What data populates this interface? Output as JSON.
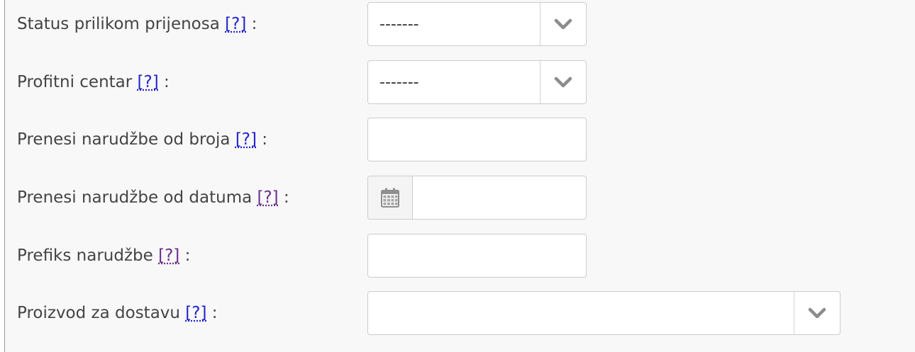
{
  "form": {
    "help_marker": "[?]",
    "rows": [
      {
        "label": "Status prilikom prijenosa",
        "value": "-------",
        "help_visited": false
      },
      {
        "label": "Profitni centar",
        "value": "-------",
        "help_visited": false
      },
      {
        "label": "Prenesi narudžbe od broja",
        "value": "",
        "help_visited": false
      },
      {
        "label": "Prenesi narudžbe od datuma",
        "value": "",
        "help_visited": true
      },
      {
        "label": "Prefiks narudžbe",
        "value": "",
        "help_visited": true
      },
      {
        "label": "Proizvod za dostavu",
        "value": "",
        "help_visited": false
      }
    ],
    "colon": ":"
  },
  "icons": {
    "select_arrow": "chevron-down-icon",
    "date_picker": "calendar-icon"
  },
  "colors": {
    "background": "#f8f8f8",
    "label_text": "#444444",
    "help_link": "#2222cc",
    "help_link_visited": "#6b2d8c",
    "field_border": "#cccccc"
  }
}
